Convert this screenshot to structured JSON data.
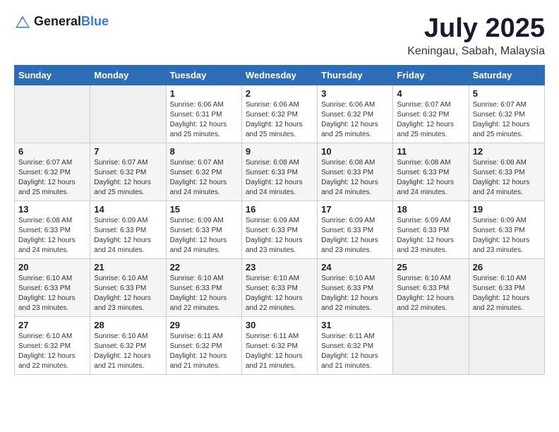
{
  "header": {
    "logo_general": "General",
    "logo_blue": "Blue",
    "title": "July 2025",
    "subtitle": "Keningau, Sabah, Malaysia"
  },
  "calendar": {
    "days_of_week": [
      "Sunday",
      "Monday",
      "Tuesday",
      "Wednesday",
      "Thursday",
      "Friday",
      "Saturday"
    ],
    "weeks": [
      [
        {
          "day": "",
          "empty": true
        },
        {
          "day": "",
          "empty": true
        },
        {
          "day": "1",
          "sunrise": "Sunrise: 6:06 AM",
          "sunset": "Sunset: 6:31 PM",
          "daylight": "Daylight: 12 hours and 25 minutes."
        },
        {
          "day": "2",
          "sunrise": "Sunrise: 6:06 AM",
          "sunset": "Sunset: 6:32 PM",
          "daylight": "Daylight: 12 hours and 25 minutes."
        },
        {
          "day": "3",
          "sunrise": "Sunrise: 6:06 AM",
          "sunset": "Sunset: 6:32 PM",
          "daylight": "Daylight: 12 hours and 25 minutes."
        },
        {
          "day": "4",
          "sunrise": "Sunrise: 6:07 AM",
          "sunset": "Sunset: 6:32 PM",
          "daylight": "Daylight: 12 hours and 25 minutes."
        },
        {
          "day": "5",
          "sunrise": "Sunrise: 6:07 AM",
          "sunset": "Sunset: 6:32 PM",
          "daylight": "Daylight: 12 hours and 25 minutes."
        }
      ],
      [
        {
          "day": "6",
          "sunrise": "Sunrise: 6:07 AM",
          "sunset": "Sunset: 6:32 PM",
          "daylight": "Daylight: 12 hours and 25 minutes."
        },
        {
          "day": "7",
          "sunrise": "Sunrise: 6:07 AM",
          "sunset": "Sunset: 6:32 PM",
          "daylight": "Daylight: 12 hours and 25 minutes."
        },
        {
          "day": "8",
          "sunrise": "Sunrise: 6:07 AM",
          "sunset": "Sunset: 6:32 PM",
          "daylight": "Daylight: 12 hours and 24 minutes."
        },
        {
          "day": "9",
          "sunrise": "Sunrise: 6:08 AM",
          "sunset": "Sunset: 6:33 PM",
          "daylight": "Daylight: 12 hours and 24 minutes."
        },
        {
          "day": "10",
          "sunrise": "Sunrise: 6:08 AM",
          "sunset": "Sunset: 6:33 PM",
          "daylight": "Daylight: 12 hours and 24 minutes."
        },
        {
          "day": "11",
          "sunrise": "Sunrise: 6:08 AM",
          "sunset": "Sunset: 6:33 PM",
          "daylight": "Daylight: 12 hours and 24 minutes."
        },
        {
          "day": "12",
          "sunrise": "Sunrise: 6:08 AM",
          "sunset": "Sunset: 6:33 PM",
          "daylight": "Daylight: 12 hours and 24 minutes."
        }
      ],
      [
        {
          "day": "13",
          "sunrise": "Sunrise: 6:08 AM",
          "sunset": "Sunset: 6:33 PM",
          "daylight": "Daylight: 12 hours and 24 minutes."
        },
        {
          "day": "14",
          "sunrise": "Sunrise: 6:09 AM",
          "sunset": "Sunset: 6:33 PM",
          "daylight": "Daylight: 12 hours and 24 minutes."
        },
        {
          "day": "15",
          "sunrise": "Sunrise: 6:09 AM",
          "sunset": "Sunset: 6:33 PM",
          "daylight": "Daylight: 12 hours and 24 minutes."
        },
        {
          "day": "16",
          "sunrise": "Sunrise: 6:09 AM",
          "sunset": "Sunset: 6:33 PM",
          "daylight": "Daylight: 12 hours and 23 minutes."
        },
        {
          "day": "17",
          "sunrise": "Sunrise: 6:09 AM",
          "sunset": "Sunset: 6:33 PM",
          "daylight": "Daylight: 12 hours and 23 minutes."
        },
        {
          "day": "18",
          "sunrise": "Sunrise: 6:09 AM",
          "sunset": "Sunset: 6:33 PM",
          "daylight": "Daylight: 12 hours and 23 minutes."
        },
        {
          "day": "19",
          "sunrise": "Sunrise: 6:09 AM",
          "sunset": "Sunset: 6:33 PM",
          "daylight": "Daylight: 12 hours and 23 minutes."
        }
      ],
      [
        {
          "day": "20",
          "sunrise": "Sunrise: 6:10 AM",
          "sunset": "Sunset: 6:33 PM",
          "daylight": "Daylight: 12 hours and 23 minutes."
        },
        {
          "day": "21",
          "sunrise": "Sunrise: 6:10 AM",
          "sunset": "Sunset: 6:33 PM",
          "daylight": "Daylight: 12 hours and 23 minutes."
        },
        {
          "day": "22",
          "sunrise": "Sunrise: 6:10 AM",
          "sunset": "Sunset: 6:33 PM",
          "daylight": "Daylight: 12 hours and 22 minutes."
        },
        {
          "day": "23",
          "sunrise": "Sunrise: 6:10 AM",
          "sunset": "Sunset: 6:33 PM",
          "daylight": "Daylight: 12 hours and 22 minutes."
        },
        {
          "day": "24",
          "sunrise": "Sunrise: 6:10 AM",
          "sunset": "Sunset: 6:33 PM",
          "daylight": "Daylight: 12 hours and 22 minutes."
        },
        {
          "day": "25",
          "sunrise": "Sunrise: 6:10 AM",
          "sunset": "Sunset: 6:33 PM",
          "daylight": "Daylight: 12 hours and 22 minutes."
        },
        {
          "day": "26",
          "sunrise": "Sunrise: 6:10 AM",
          "sunset": "Sunset: 6:33 PM",
          "daylight": "Daylight: 12 hours and 22 minutes."
        }
      ],
      [
        {
          "day": "27",
          "sunrise": "Sunrise: 6:10 AM",
          "sunset": "Sunset: 6:32 PM",
          "daylight": "Daylight: 12 hours and 22 minutes."
        },
        {
          "day": "28",
          "sunrise": "Sunrise: 6:10 AM",
          "sunset": "Sunset: 6:32 PM",
          "daylight": "Daylight: 12 hours and 21 minutes."
        },
        {
          "day": "29",
          "sunrise": "Sunrise: 6:11 AM",
          "sunset": "Sunset: 6:32 PM",
          "daylight": "Daylight: 12 hours and 21 minutes."
        },
        {
          "day": "30",
          "sunrise": "Sunrise: 6:11 AM",
          "sunset": "Sunset: 6:32 PM",
          "daylight": "Daylight: 12 hours and 21 minutes."
        },
        {
          "day": "31",
          "sunrise": "Sunrise: 6:11 AM",
          "sunset": "Sunset: 6:32 PM",
          "daylight": "Daylight: 12 hours and 21 minutes."
        },
        {
          "day": "",
          "empty": true
        },
        {
          "day": "",
          "empty": true
        }
      ]
    ]
  }
}
